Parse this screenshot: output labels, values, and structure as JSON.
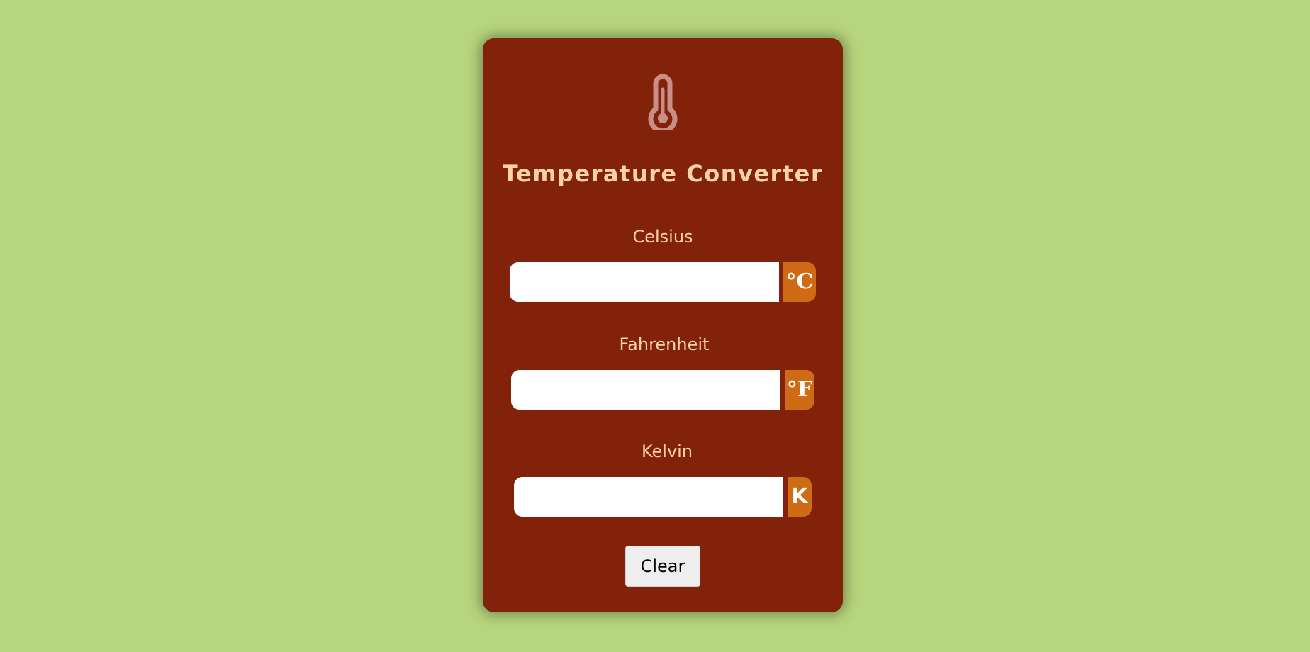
{
  "app": {
    "title": "Temperature Converter",
    "icon": "thermometer-icon"
  },
  "fields": [
    {
      "label": "Celsius",
      "unit": "°C",
      "value": "",
      "placeholder": ""
    },
    {
      "label": "Fahrenheit",
      "unit": "°F",
      "value": "",
      "placeholder": ""
    },
    {
      "label": "Kelvin",
      "unit": "K",
      "value": "",
      "placeholder": ""
    }
  ],
  "actions": {
    "clear_label": "Clear"
  },
  "colors": {
    "background": "#b7d57c",
    "card": "#82220a",
    "text": "#fbd3a7",
    "unit_badge": "#cf6b14",
    "icon": "#c98f86"
  }
}
